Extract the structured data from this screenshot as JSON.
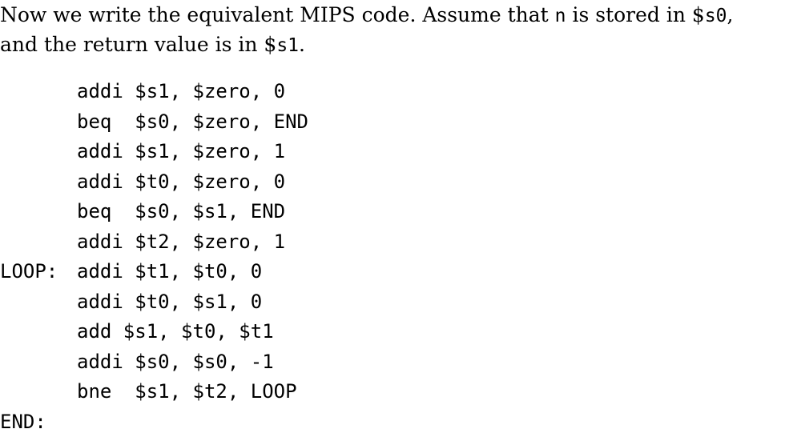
{
  "intro": {
    "line1_a": "Now we write the equivalent MIPS code.  Assume that ",
    "line1_var": "n",
    "line1_b": " is stored in $",
    "line1_reg": "s0",
    "line1_c": ",",
    "line2_a": "and the return value is in $",
    "line2_reg": "s1",
    "line2_b": "."
  },
  "code": [
    {
      "label": "",
      "instr": "addi $s1, $zero, 0"
    },
    {
      "label": "",
      "instr": "beq  $s0, $zero, END"
    },
    {
      "label": "",
      "instr": "addi $s1, $zero, 1"
    },
    {
      "label": "",
      "instr": "addi $t0, $zero, 0"
    },
    {
      "label": "",
      "instr": "beq  $s0, $s1, END"
    },
    {
      "label": "",
      "instr": "addi $t2, $zero, 1"
    },
    {
      "label": "LOOP:",
      "instr": "addi $t1, $t0, 0"
    },
    {
      "label": "",
      "instr": "addi $t0, $s1, 0"
    },
    {
      "label": "",
      "instr": "add $s1, $t0, $t1"
    },
    {
      "label": "",
      "instr": "addi $s0, $s0, -1"
    },
    {
      "label": "",
      "instr": "bne  $s1, $t2, LOOP"
    },
    {
      "label": "END:",
      "instr": ""
    }
  ]
}
